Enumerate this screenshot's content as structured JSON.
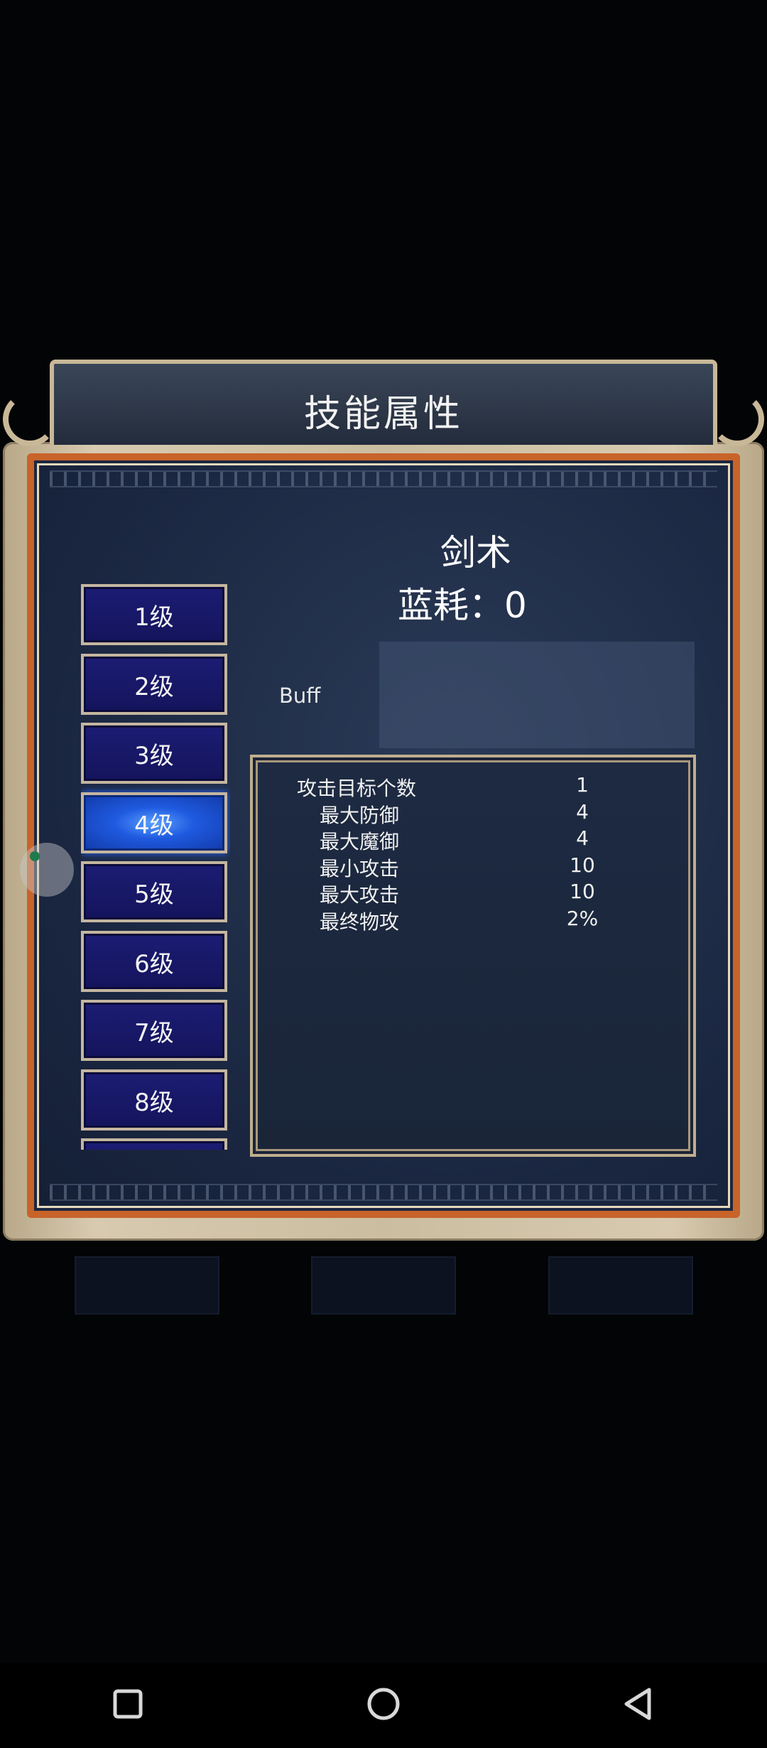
{
  "dialog": {
    "title": "技能属性"
  },
  "skill": {
    "name": "剑术",
    "mana_label": "蓝耗：",
    "mana_value": "0",
    "buff_label": "Buff"
  },
  "levels": {
    "items": [
      "1级",
      "2级",
      "3级",
      "4级",
      "5级",
      "6级",
      "7级",
      "8级"
    ],
    "selected": "4级"
  },
  "attributes": [
    {
      "name": "攻击目标个数",
      "value": "1"
    },
    {
      "name": "最大防御",
      "value": "4"
    },
    {
      "name": "最大魔御",
      "value": "4"
    },
    {
      "name": "最小攻击",
      "value": "10"
    },
    {
      "name": "最大攻击",
      "value": "10"
    },
    {
      "name": "最终物攻",
      "value": "2%"
    }
  ],
  "background_buttons": {
    "left": "",
    "center": "",
    "right": ""
  },
  "nav": {
    "icons": [
      "recent-apps-icon",
      "home-icon",
      "back-icon"
    ]
  },
  "colors": {
    "frame_gold": "#c8b898",
    "frame_orange": "#c8632a",
    "panel_blue": "#1c2840",
    "level_button": "#1c1c74",
    "level_selected": "#1f5ae0"
  }
}
